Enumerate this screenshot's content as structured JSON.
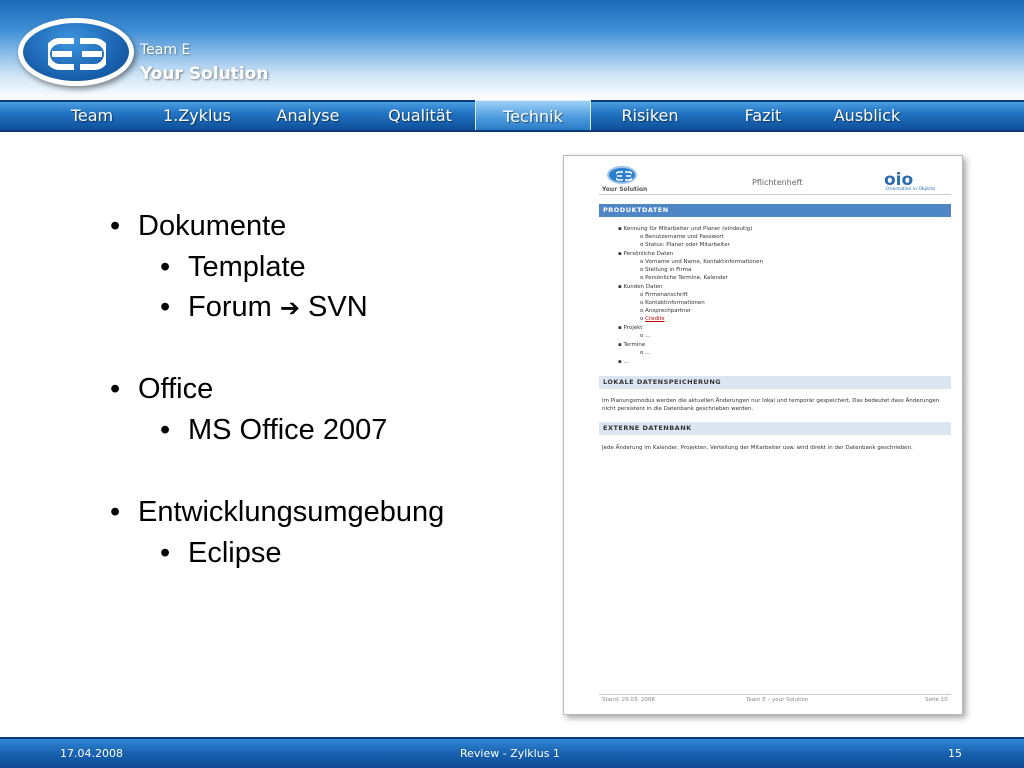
{
  "header": {
    "brand_small": "Team E",
    "brand_big": "Your Solution",
    "logo_icon": "team-e-logo"
  },
  "nav": {
    "items": [
      {
        "label": "Team",
        "active": false
      },
      {
        "label": "1.Zyklus",
        "active": false
      },
      {
        "label": "Analyse",
        "active": false
      },
      {
        "label": "Qualität",
        "active": false
      },
      {
        "label": "Technik",
        "active": true
      },
      {
        "label": "Risiken",
        "active": false
      },
      {
        "label": "Fazit",
        "active": false
      },
      {
        "label": "Ausblick",
        "active": false
      }
    ]
  },
  "content": {
    "bullets": [
      {
        "text": "Dokumente",
        "children": [
          "Template",
          "Forum",
          "MS Office 2007",
          "Eclipse"
        ]
      },
      {
        "text": "Office"
      },
      {
        "text": "Entwicklungsumgebung"
      }
    ],
    "b1": "Dokumente",
    "b1_1": "Template",
    "b1_2a": "Forum",
    "b1_2b": "SVN",
    "b2": "Office",
    "b2_1": "MS Office 2007",
    "b3": "Entwicklungsumgebung",
    "b3_1": "Eclipse"
  },
  "document": {
    "brand": "Your Solution",
    "title": "Pflichtenheft",
    "partner_logo_text": "oio",
    "partner_sub": "Orientation in Objects",
    "section1": "PRODUKTDATEN",
    "l1": "Kennung für Mitarbeiter und Planer (eindeutig)",
    "l1a": "Benutzername und Passwort",
    "l1b": "Status: Planer oder Mitarbeiter",
    "l2": "Persönliche Daten",
    "l2a": "Vorname und Name, Kontaktinformationen",
    "l2b": "Stellung in Firma",
    "l2c": "Persönliche Termine, Kalender",
    "l3": "Kunden Daten",
    "l3a": "Firmenanschrift",
    "l3b": "Kontaktinformationen",
    "l3c": "Ansprechpartner",
    "l3d": "Credits",
    "l4": "Projekt",
    "l4a": "…",
    "l5": "Termine",
    "l5a": "…",
    "l6": "…",
    "section2": "LOKALE DATENSPEICHERUNG",
    "para2": "Im Planungsmodus werden die aktuellen Änderungen nur lokal und temporär gespeichert. Das bedeutet dass Änderungen nicht persistent in die Datenbank geschrieben werden.",
    "section3": "EXTERNE DATENBANK",
    "para3": "Jede Änderung im Kalender, Projekten, Verteilung der Mitarbeiter usw. wird direkt in der Datenbank geschrieben.",
    "footer_left": "Stand: 29.03. 2008",
    "footer_mid": "Team E – your Solution",
    "footer_right": "Seite 10"
  },
  "footer": {
    "date": "17.04.2008",
    "title": "Review - Zylklus 1",
    "page": "15"
  },
  "colors": {
    "nav_blue": "#1a63b0",
    "section_blue": "#4f86c6",
    "link_red": "#c00000"
  }
}
